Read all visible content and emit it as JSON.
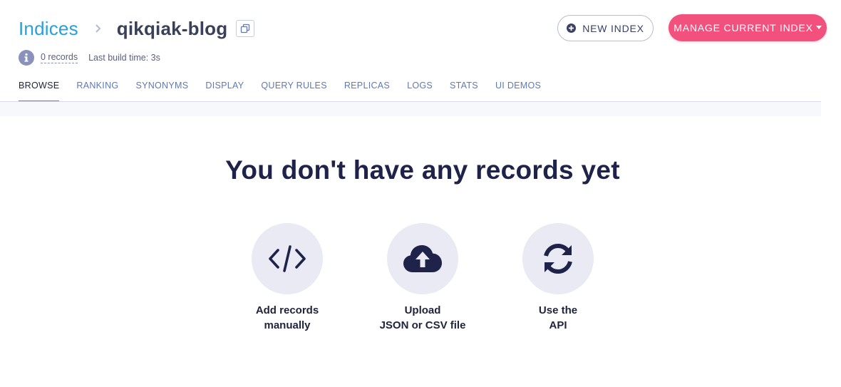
{
  "breadcrumb": {
    "root": "Indices",
    "current": "qikqiak-blog"
  },
  "meta": {
    "records": "0 records",
    "build_time": "Last build time: 3s"
  },
  "buttons": {
    "new_index": "NEW INDEX",
    "manage_index": "MANAGE CURRENT INDEX"
  },
  "tabs": [
    {
      "label": "BROWSE",
      "active": true
    },
    {
      "label": "RANKING"
    },
    {
      "label": "SYNONYMS"
    },
    {
      "label": "DISPLAY"
    },
    {
      "label": "QUERY RULES"
    },
    {
      "label": "REPLICAS"
    },
    {
      "label": "LOGS"
    },
    {
      "label": "STATS"
    },
    {
      "label": "UI DEMOS"
    }
  ],
  "empty_state": {
    "title": "You don't have any records yet",
    "options": [
      {
        "line1": "Add records",
        "line2": "manually",
        "icon": "code-icon"
      },
      {
        "line1": "Upload",
        "line2": "JSON or CSV file",
        "icon": "cloud-upload-icon"
      },
      {
        "line1": "Use the",
        "line2": "API",
        "icon": "sync-icon"
      }
    ]
  },
  "colors": {
    "accent": "#2a9fd8",
    "primary_button": "#f2507d",
    "heading": "#1f234a",
    "tab": "#5f79b6"
  }
}
